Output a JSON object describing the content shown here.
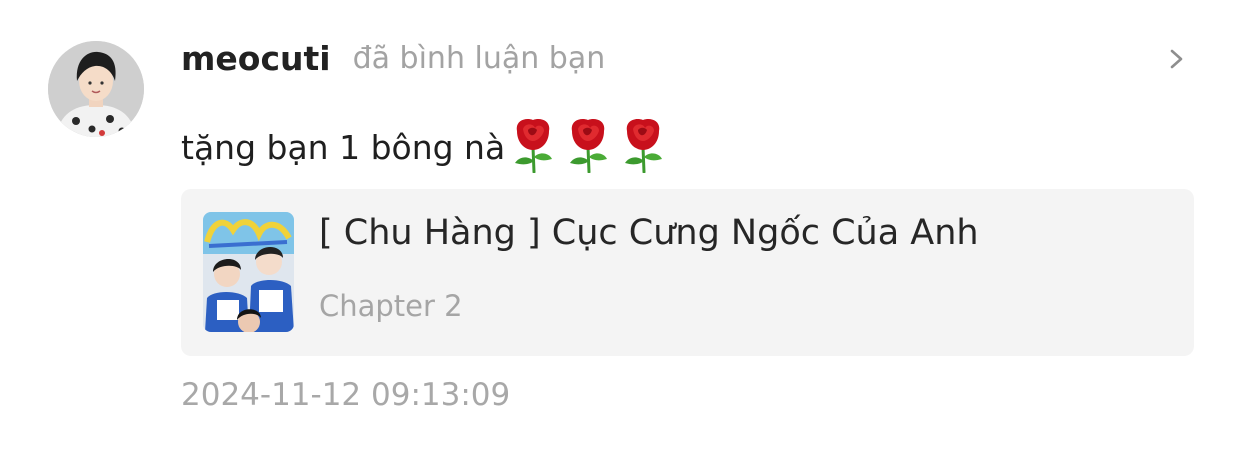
{
  "notification": {
    "username": "meocuti",
    "action_text": "đã bình luận bạn",
    "comment_text": "tặng bạn 1 bông nà",
    "comment_emojis": [
      "rose",
      "rose",
      "rose"
    ],
    "story": {
      "title": "[ Chu Hàng ] Cục Cưng Ngốc Của Anh",
      "chapter": "Chapter 2"
    },
    "timestamp": "2024-11-12 09:13:09"
  },
  "icons": {
    "open": "chevron-right-icon",
    "emoji": "rose-emoji-icon"
  },
  "colors": {
    "username": "#222222",
    "muted_text": "#a3a3a3",
    "card_background": "#f4f4f4",
    "rose": "#c8101c",
    "leaf": "#3c9a2e"
  }
}
